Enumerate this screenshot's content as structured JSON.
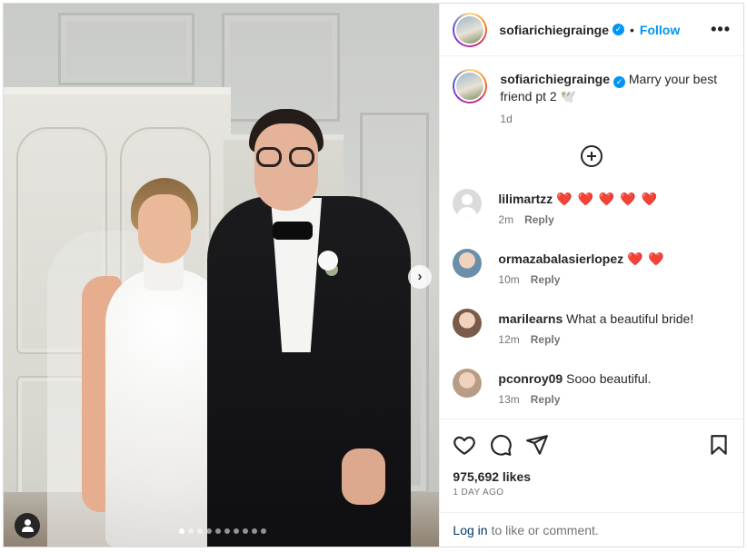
{
  "post": {
    "username": "sofiarichiegrainge",
    "verified": true,
    "separator": "•",
    "follow_label": "Follow",
    "more_label": "•••",
    "caption": "Marry your best friend pt 2 🕊️",
    "caption_time": "1d",
    "likes": "975,692 likes",
    "date": "1 DAY AGO"
  },
  "media": {
    "next_label": "›",
    "carousel_count": 10,
    "carousel_active": 0
  },
  "comments": [
    {
      "username": "lilimartzz",
      "text": "",
      "hearts": "❤️ ❤️ ❤️ ❤️ ❤️",
      "time": "2m",
      "reply": "Reply",
      "avatar": "default"
    },
    {
      "username": "ormazabalasierlopez",
      "text": "",
      "hearts": "❤️ ❤️",
      "time": "10m",
      "reply": "Reply",
      "avatar": "#6b8fa8"
    },
    {
      "username": "marilearns",
      "text": "What a beautiful bride!",
      "hearts": "",
      "time": "12m",
      "reply": "Reply",
      "avatar": "#7a5a48"
    },
    {
      "username": "pconroy09",
      "text": "Sooo beautiful.",
      "hearts": "",
      "time": "13m",
      "reply": "Reply",
      "avatar": "#b89d86"
    }
  ],
  "footer": {
    "login_link": "Log in",
    "login_text": "to like or comment."
  },
  "colors": {
    "accent": "#0095f6",
    "heart": "#ed1e3a",
    "text": "#262626",
    "muted": "#737373"
  }
}
